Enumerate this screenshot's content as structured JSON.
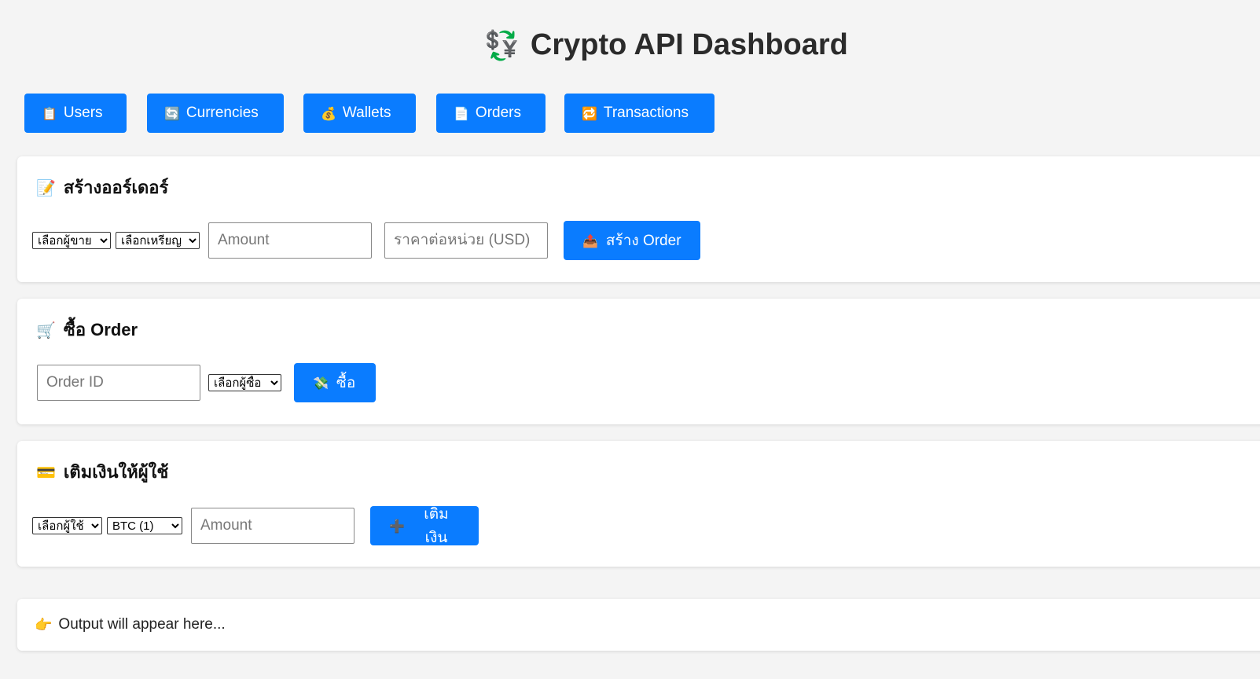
{
  "header": {
    "icon": "💱",
    "icon_name": "currency-exchange-icon",
    "title": "Crypto API Dashboard"
  },
  "nav": [
    {
      "icon": "📋",
      "label": "Users"
    },
    {
      "icon": "🔄",
      "label": "Currencies"
    },
    {
      "icon": "💰",
      "label": "Wallets"
    },
    {
      "icon": "📄",
      "label": "Orders"
    },
    {
      "icon": "🔁",
      "label": "Transactions"
    }
  ],
  "create_order": {
    "icon": "📝",
    "title": "สร้างออร์เดอร์",
    "seller_select": "เลือกผู้ขาย",
    "coin_select": "เลือกเหรียญ",
    "amount_placeholder": "Amount",
    "price_placeholder": "ราคาต่อหน่วย (USD)",
    "button_icon": "📤",
    "button_label": "สร้าง Order"
  },
  "buy_order": {
    "icon": "🛒",
    "title": "ซื้อ Order",
    "order_id_placeholder": "Order ID",
    "buyer_select": "เลือกผู้ซื้อ",
    "button_icon": "💸",
    "button_label": "ซื้อ"
  },
  "topup": {
    "icon": "💳",
    "title": "เติมเงินให้ผู้ใช้",
    "user_select": "เลือกผู้ใช้",
    "currency_select": "BTC (1)",
    "amount_placeholder": "Amount",
    "button_icon": "➕",
    "button_label": "เติมเงิน"
  },
  "output": {
    "icon": "👉",
    "text": "Output will appear here..."
  },
  "colors": {
    "accent": "#0a7cff",
    "background": "#f4f4f4",
    "card": "#ffffff"
  }
}
